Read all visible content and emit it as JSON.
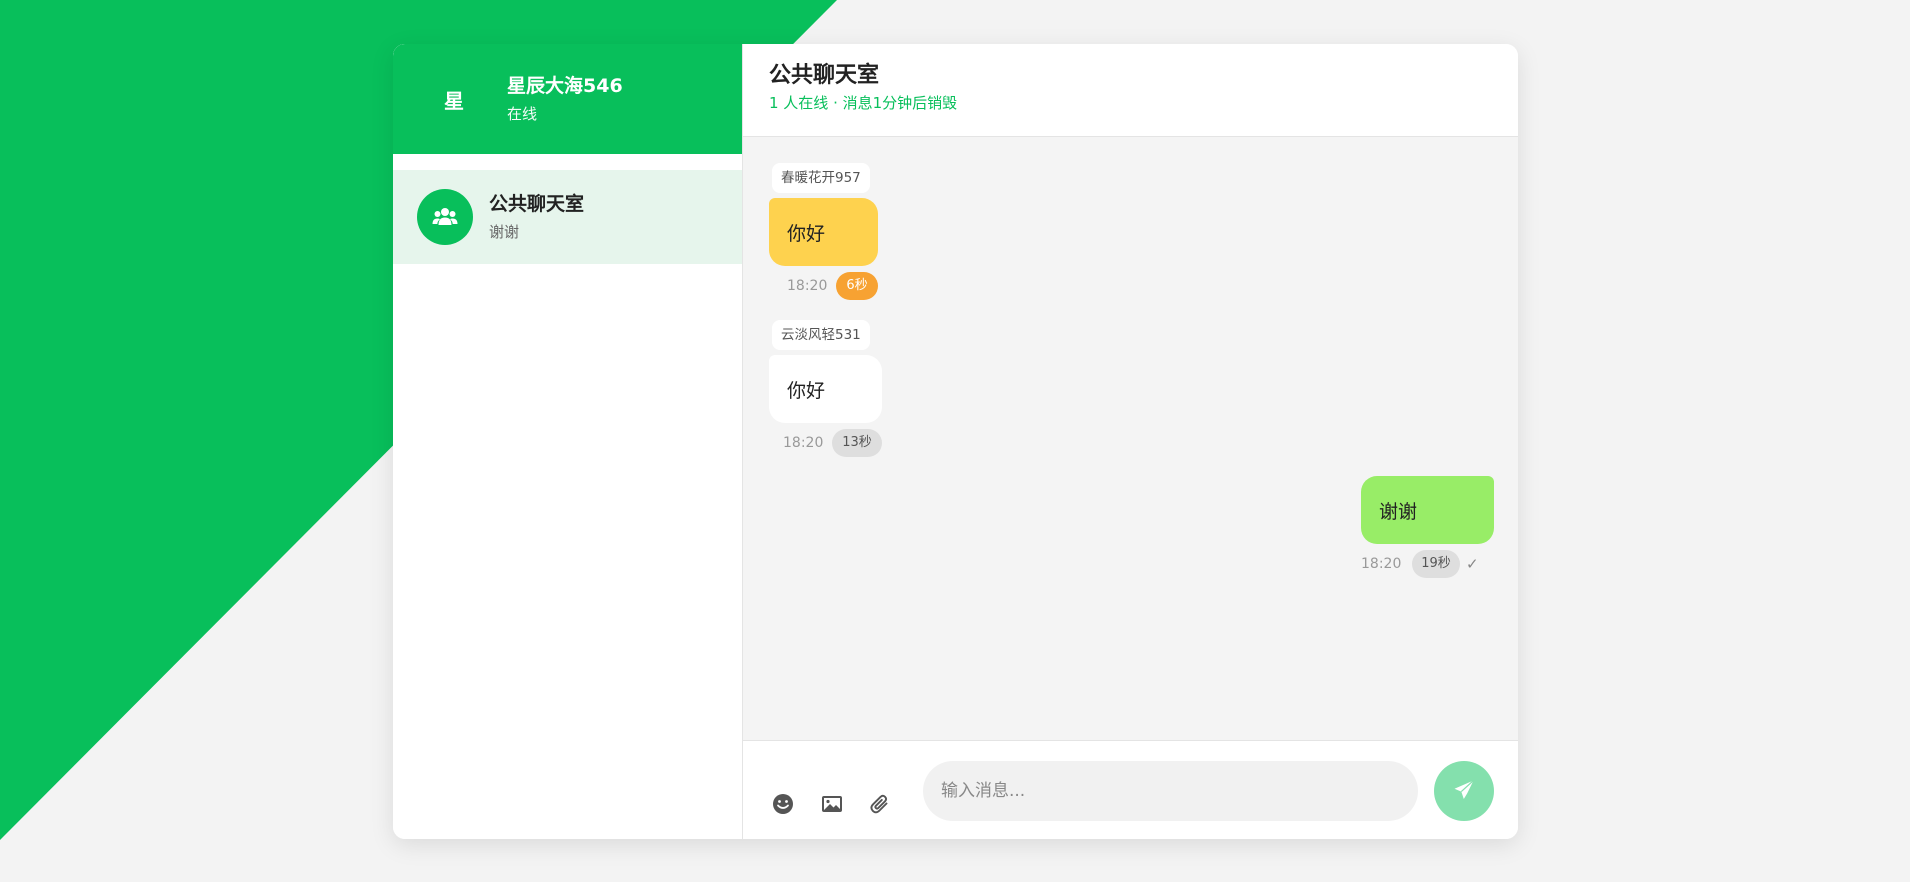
{
  "user": {
    "avatar_text": "星",
    "name": "星辰大海546",
    "status": "在线"
  },
  "rooms": [
    {
      "name": "公共聊天室",
      "last_message": "谢谢",
      "icon": "users-icon"
    }
  ],
  "chat": {
    "title": "公共聊天室",
    "subtitle": "1 人在线 · 消息1分钟后销毁",
    "messages": [
      {
        "sender": "春暖花开957",
        "text": "你好",
        "time": "18:20",
        "timer": "6秒",
        "side": "left",
        "color": "#fed24e"
      },
      {
        "sender": "云淡风轻531",
        "text": "你好",
        "time": "18:20",
        "timer": "13秒",
        "side": "left",
        "color": "#ffffff"
      },
      {
        "text": "谢谢",
        "time": "18:20",
        "timer": "19秒",
        "side": "right",
        "color": "#98ed67",
        "status_icon": "check-icon"
      }
    ]
  },
  "input": {
    "placeholder": "输入消息...",
    "tools": [
      "smile-icon",
      "image-icon",
      "paperclip-icon"
    ],
    "send_icon": "paper-plane-icon"
  },
  "colors": {
    "accent": "#08bf5b",
    "selected_room_bg": "#e6f5ec",
    "send_button": "#84e0ad",
    "timer_orange": "#f7a232"
  }
}
